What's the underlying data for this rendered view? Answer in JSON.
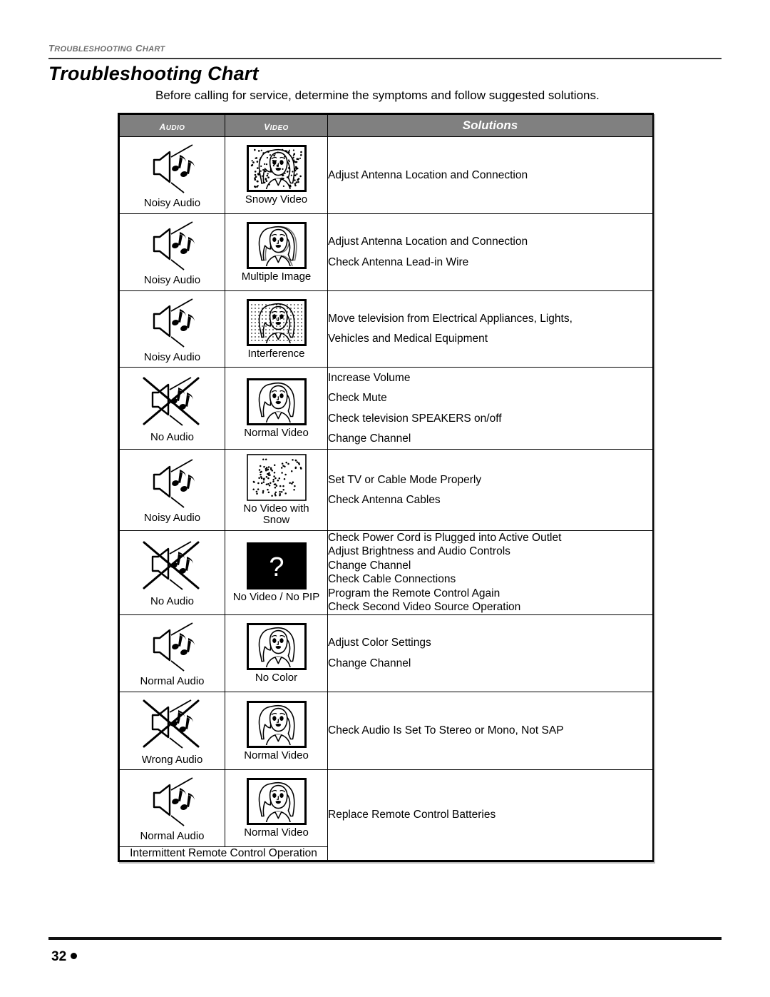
{
  "running_header": "Troubleshooting Chart",
  "page_title": "Troubleshooting Chart",
  "intro": "Before calling for service, determine the symptoms and follow suggested solutions.",
  "table": {
    "headers": {
      "audio": "Audio",
      "video": "Video",
      "solutions": "Solutions"
    },
    "rows": [
      {
        "audio": {
          "caption": "Noisy Audio",
          "icon": "speaker-noisy-icon"
        },
        "video": {
          "caption": "Snowy Video",
          "icon": "tv-snowy-face-icon"
        },
        "solutions": [
          "Adjust Antenna Location and Connection"
        ]
      },
      {
        "audio": {
          "caption": "Noisy Audio",
          "icon": "speaker-noisy-icon"
        },
        "video": {
          "caption": "Multiple Image",
          "icon": "tv-multiple-image-icon"
        },
        "solutions": [
          "Adjust Antenna Location and Connection",
          "Check Antenna Lead-in Wire"
        ]
      },
      {
        "audio": {
          "caption": "Noisy Audio",
          "icon": "speaker-noisy-icon"
        },
        "video": {
          "caption": "Interference",
          "icon": "tv-interference-icon"
        },
        "solutions": [
          "Move television from Electrical Appliances, Lights,",
          "Vehicles and Medical Equipment"
        ]
      },
      {
        "audio": {
          "caption": "No Audio",
          "icon": "speaker-crossed-icon"
        },
        "video": {
          "caption": "Normal Video",
          "icon": "tv-normal-face-icon"
        },
        "solutions": [
          "Increase Volume",
          "Check Mute",
          "Check television SPEAKERS on/off",
          "Change Channel"
        ]
      },
      {
        "audio": {
          "caption": "Noisy Audio",
          "icon": "speaker-noisy-icon"
        },
        "video": {
          "caption": "No Video with\nSnow",
          "icon": "tv-snow-only-icon"
        },
        "solutions": [
          "Set TV or Cable Mode Properly",
          "Check Antenna Cables"
        ]
      },
      {
        "audio": {
          "caption": "No Audio",
          "icon": "speaker-crossed-icon"
        },
        "video": {
          "caption": "No Video / No PIP",
          "icon": "tv-question-mark-icon"
        },
        "solutions": [
          "Check Power Cord is Plugged into Active Outlet",
          "Adjust Brightness and Audio Controls",
          "Change Channel",
          "Check Cable Connections",
          "Program the Remote Control Again",
          "Check Second Video Source Operation"
        ]
      },
      {
        "audio": {
          "caption": "Normal Audio",
          "icon": "speaker-noisy-icon"
        },
        "video": {
          "caption": "No Color",
          "icon": "tv-no-color-icon"
        },
        "solutions": [
          "Adjust Color Settings",
          "Change Channel"
        ]
      },
      {
        "audio": {
          "caption": "Wrong Audio",
          "icon": "speaker-crossed-icon"
        },
        "video": {
          "caption": "Normal Video",
          "icon": "tv-normal-face-icon"
        },
        "solutions": [
          "Check Audio Is Set To Stereo or Mono, Not SAP"
        ]
      },
      {
        "audio": {
          "caption": "Normal Audio",
          "icon": "speaker-noisy-icon"
        },
        "video": {
          "caption": "Normal Video",
          "icon": "tv-normal-face-icon"
        },
        "solutions": [
          "Replace Remote Control Batteries"
        ],
        "span_label": "Intermittent Remote Control Operation"
      }
    ]
  },
  "footer": {
    "page_number": "32"
  },
  "colors": {
    "header_gray": "#808080",
    "running_header_gray": "#6e6e6e",
    "rule_black": "#111111"
  }
}
